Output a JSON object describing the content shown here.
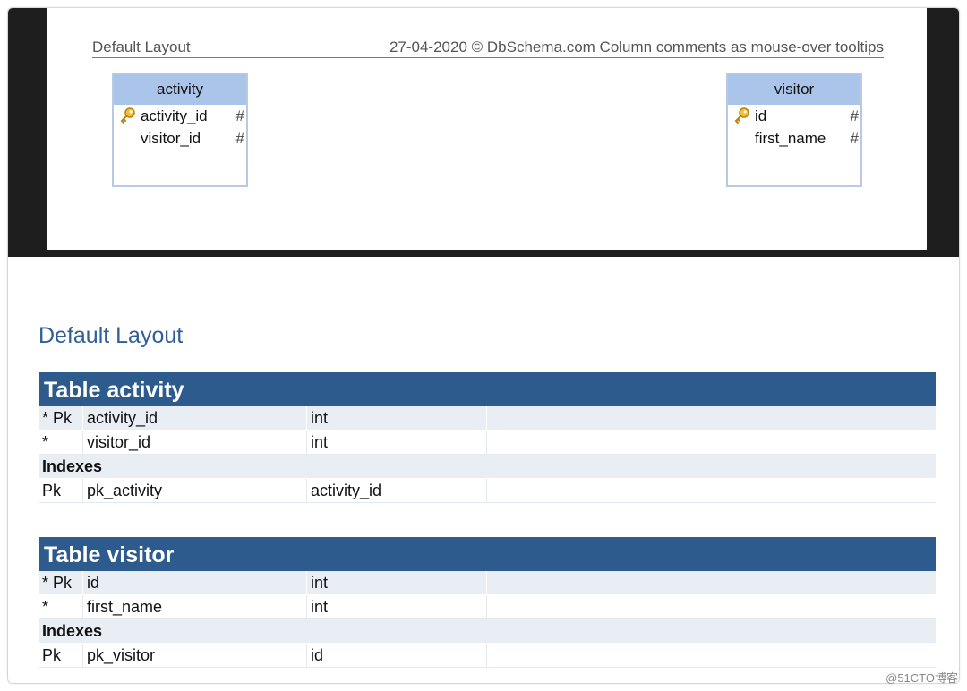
{
  "diagram": {
    "header_left": "Default Layout",
    "header_right": "27-04-2020 © DbSchema.com Column comments as mouse-over tooltips",
    "entities": [
      {
        "name": "activity",
        "columns": [
          {
            "name": "activity_id",
            "type": "#",
            "key": true
          },
          {
            "name": "visitor_id",
            "type": "#",
            "key": false
          }
        ]
      },
      {
        "name": "visitor",
        "columns": [
          {
            "name": "id",
            "type": "#",
            "key": true
          },
          {
            "name": "first_name",
            "type": "#",
            "key": false
          }
        ]
      }
    ]
  },
  "doc": {
    "title": "Default Layout",
    "tables": [
      {
        "title": "Table activity",
        "rows": [
          [
            "* Pk",
            "activity_id",
            "int",
            ""
          ],
          [
            "*",
            "visitor_id",
            "int",
            ""
          ]
        ],
        "indexes_label": "Indexes",
        "indexes": [
          [
            "Pk",
            "pk_activity",
            "activity_id",
            ""
          ]
        ]
      },
      {
        "title": "Table visitor",
        "rows": [
          [
            "* Pk",
            "id",
            "int",
            ""
          ],
          [
            "*",
            "first_name",
            "int",
            ""
          ]
        ],
        "indexes_label": "Indexes",
        "indexes": [
          [
            "Pk",
            "pk_visitor",
            "id",
            ""
          ]
        ]
      }
    ]
  },
  "watermark": "@51CTO博客",
  "colors": {
    "header_blue": "#2d5b8e",
    "title_blue": "#2f5f96",
    "entity_header": "#aac4ea",
    "row_alt": "#e9edf4"
  }
}
